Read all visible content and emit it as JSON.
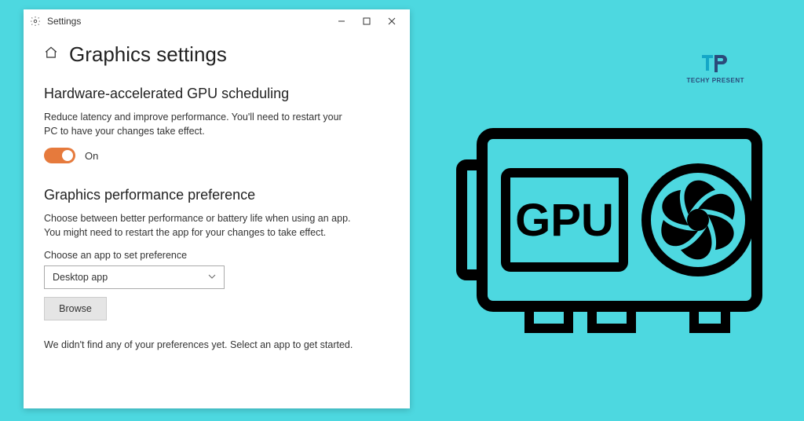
{
  "window": {
    "title": "Settings"
  },
  "page": {
    "title": "Graphics settings"
  },
  "gpu_scheduling": {
    "heading": "Hardware-accelerated GPU scheduling",
    "description": "Reduce latency and improve performance. You'll need to restart your PC to have your changes take effect.",
    "toggle_state": "On"
  },
  "performance_pref": {
    "heading": "Graphics performance preference",
    "description": "Choose between better performance or battery life when using an app. You might need to restart the app for your changes to take effect.",
    "field_label": "Choose an app to set preference",
    "select_value": "Desktop app",
    "browse_label": "Browse",
    "empty_message": "We didn't find any of your preferences yet. Select an app to get started."
  },
  "brand": {
    "name": "TECHY PRESENT"
  },
  "gpu_card_label": "GPU"
}
